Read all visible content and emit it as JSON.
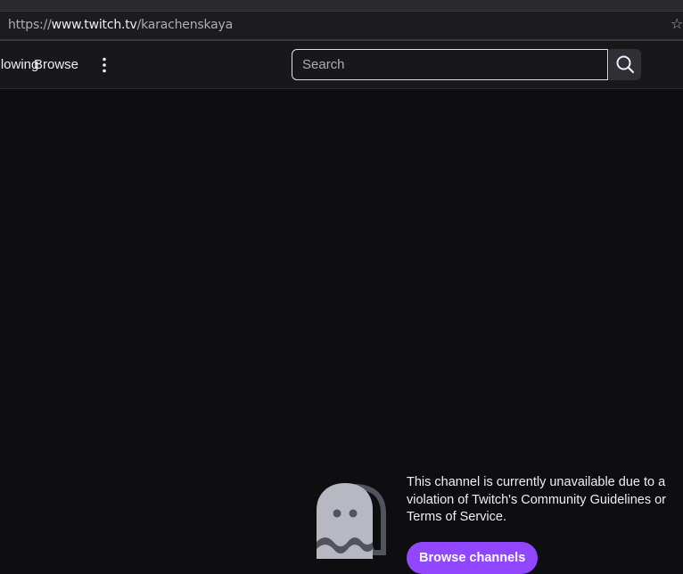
{
  "browser": {
    "url_prefix": "https://",
    "url_domain": "www.twitch.tv",
    "url_path": "/karachenskaya",
    "bookmark_icon": "star-icon"
  },
  "nav": {
    "following_label": "Following",
    "browse_label": "Browse",
    "more_icon": "vertical-dots-icon",
    "search_placeholder": "Search",
    "search_icon": "search-icon"
  },
  "main": {
    "message": "This channel is currently unavailable due to a violation of Twitch's Community Guidelines or Terms of Service.",
    "browse_button_label": "Browse channels",
    "illustration_icon": "ghost-icon"
  },
  "colors": {
    "accent": "#9147ff",
    "background": "#0e0e10",
    "nav_background": "#18181b"
  }
}
